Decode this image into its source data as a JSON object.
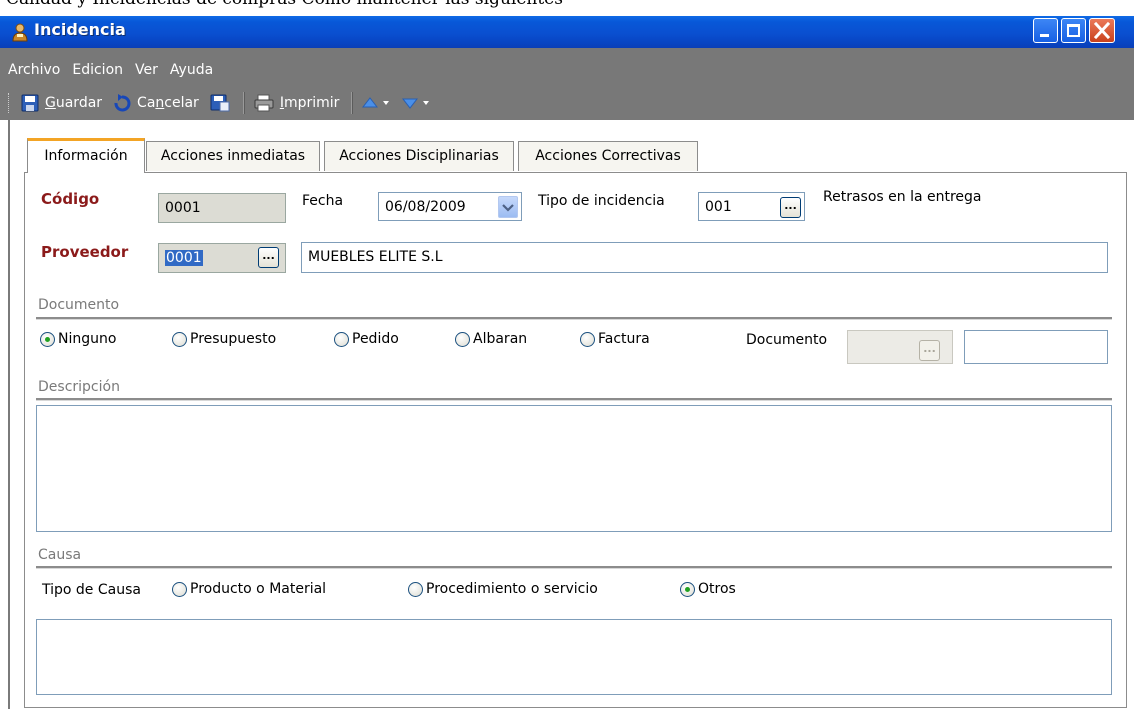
{
  "top_text": "Calidad y Incidencias de compras  Como mantener las siguientes",
  "window": {
    "title": "Incidencia"
  },
  "menu": {
    "archivo": {
      "u": "A",
      "rest": "rchivo"
    },
    "edicion": {
      "u": "E",
      "rest": "dicion"
    },
    "ver": {
      "u": "V",
      "rest": "er"
    },
    "ayuda": {
      "pre": "Ay",
      "u": "u",
      "rest": "da"
    }
  },
  "toolbar": {
    "guardar": {
      "u": "G",
      "rest": "uardar"
    },
    "cancelar": {
      "pre": "Ca",
      "u": "n",
      "rest": "celar"
    },
    "imprimir": {
      "u": "I",
      "rest": "mprimir"
    }
  },
  "tabs": [
    "Información",
    "Acciones inmediatas",
    "Acciones Disciplinarias",
    "Acciones Correctivas"
  ],
  "form": {
    "codigo_label": "Código",
    "codigo_value": "0001",
    "fecha_label": "Fecha",
    "fecha_value": "06/08/2009",
    "tipo_incidencia_label": "Tipo de incidencia",
    "tipo_incidencia_value": "001",
    "tipo_incidencia_desc": "Retrasos en la entrega",
    "proveedor_label": "Proveedor",
    "proveedor_code": "0001",
    "proveedor_name": "MUEBLES ELITE S.L",
    "ellipsis": "...",
    "documento_section": "Documento",
    "doc_options": [
      "Ninguno",
      "Presupuesto",
      "Pedido",
      "Albaran",
      "Factura"
    ],
    "doc_selected": "Ninguno",
    "documento_label": "Documento",
    "descripcion_section": "Descripción",
    "causa_section": "Causa",
    "tipo_causa_label": "Tipo de Causa",
    "causa_options": [
      "Producto o Material",
      "Procedimiento o servicio",
      "Otros"
    ],
    "causa_selected": "Otros"
  },
  "colors": {
    "titlebar": "#0a4fd0",
    "toolbar_band": "#787878",
    "label_red": "#8b1a1a",
    "tab_accent": "#f3a425",
    "radio_dot": "#21a121"
  }
}
